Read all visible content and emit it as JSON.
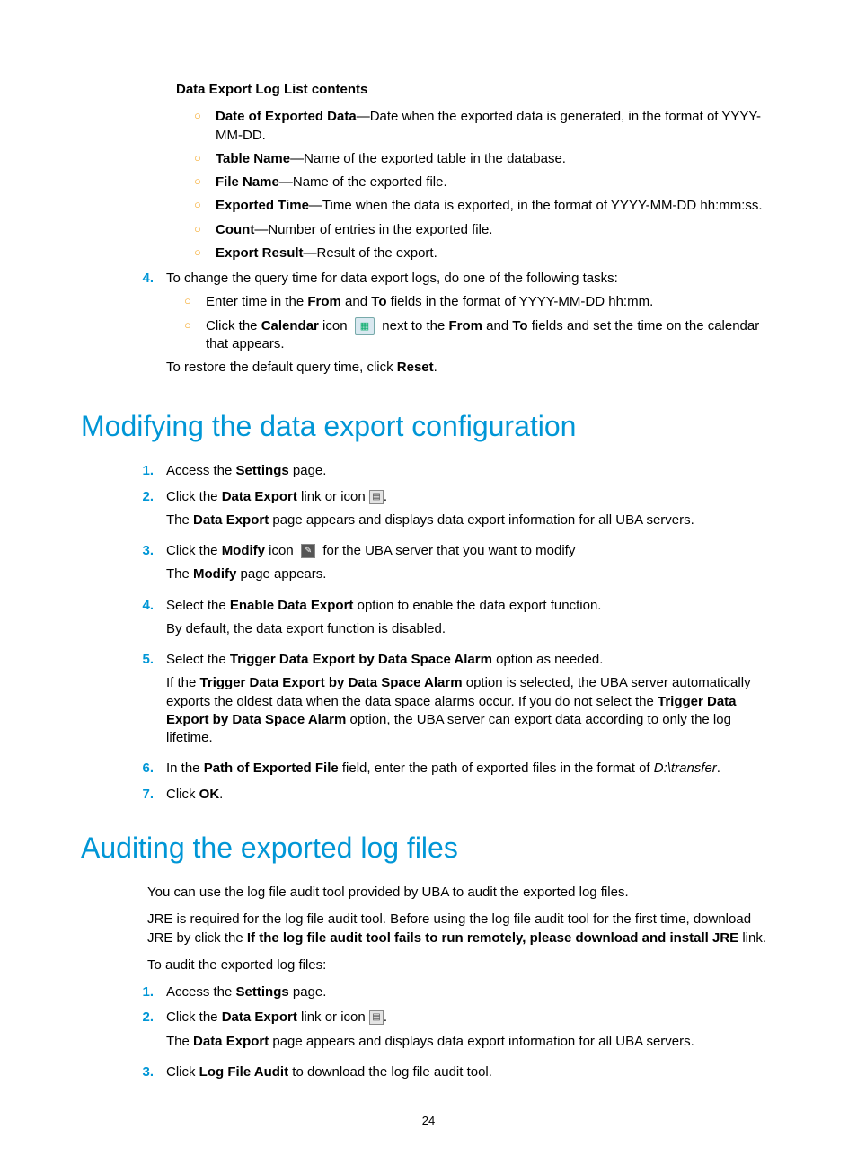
{
  "sectionA": {
    "hdr": "Data Export Log List contents",
    "items": [
      {
        "b": "Date of Exported Data",
        "d": "—Date when the exported data is generated, in the format of YYYY-MM-DD."
      },
      {
        "b": "Table Name",
        "d": "—Name of the exported table in the database."
      },
      {
        "b": "File Name",
        "d": "—Name of the exported file."
      },
      {
        "b": "Exported Time",
        "d": "—Time when the data is exported, in the format of YYYY-MM-DD hh:mm:ss."
      },
      {
        "b": "Count",
        "d": "—Number of entries in the exported file."
      },
      {
        "b": "Export Result",
        "d": "—Result of the export."
      }
    ]
  },
  "step4": {
    "n": "4.",
    "lead": "To change the query time for data export logs, do one of the following tasks:",
    "sub1a": "Enter time in the ",
    "sub1b": "From",
    "sub1c": " and ",
    "sub1d": "To",
    "sub1e": " fields in the format of YYYY-MM-DD hh:mm.",
    "sub2a": "Click the ",
    "sub2b": "Calendar",
    "sub2c": " icon ",
    "sub2d": " next to the ",
    "sub2e": "From",
    "sub2f": " and ",
    "sub2g": "To",
    "sub2h": " fields and set the time on the calendar that appears.",
    "tail1": "To restore the default query time, click ",
    "tail2": "Reset",
    "tail3": "."
  },
  "h1": "Modifying the data export configuration",
  "mod": {
    "s1": {
      "n": "1.",
      "a": "Access the ",
      "b": "Settings",
      "c": " page."
    },
    "s2": {
      "n": "2.",
      "a": "Click the ",
      "b": "Data Export",
      "c": " link or icon ",
      "d": ".",
      "p1a": "The ",
      "p1b": "Data Export",
      "p1c": " page appears and displays data export information for all UBA servers."
    },
    "s3": {
      "n": "3.",
      "a": "Click the ",
      "b": "Modify",
      "c": " icon ",
      "d": " for the UBA server that you want to modify",
      "p1a": "The ",
      "p1b": "Modify",
      "p1c": " page appears."
    },
    "s4": {
      "n": "4.",
      "a": "Select the ",
      "b": "Enable Data Export",
      "c": " option to enable the data export function.",
      "p1": "By default, the data export function is disabled."
    },
    "s5": {
      "n": "5.",
      "a": "Select the ",
      "b": "Trigger Data Export by Data Space Alarm",
      "c": " option as needed.",
      "p1a": "If the ",
      "p1b": "Trigger Data Export by Data Space Alarm",
      "p1c": " option is selected, the UBA server automatically exports the oldest data when the data space alarms occur. If you do not select the ",
      "p1d": "Trigger Data Export by Data Space Alarm",
      "p1e": " option, the UBA server can export data according to only the log lifetime."
    },
    "s6": {
      "n": "6.",
      "a": "In the ",
      "b": "Path of Exported File",
      "c": " field, enter the path of exported files in the format of ",
      "d": "D:\\transfer",
      "e": "."
    },
    "s7": {
      "n": "7.",
      "a": "Click ",
      "b": "OK",
      "c": "."
    }
  },
  "h2": "Auditing the exported log files",
  "aud": {
    "p1": "You can use the log file audit tool provided by UBA to audit the exported log files.",
    "p2a": "JRE is required for the log file audit tool. Before using the log file audit tool for the first time, download JRE by click the ",
    "p2b": "If the log file audit tool fails to run remotely, please download and install JRE",
    "p2c": " link.",
    "p3": "To audit the exported log files:",
    "s1": {
      "n": "1.",
      "a": "Access the ",
      "b": "Settings",
      "c": " page."
    },
    "s2": {
      "n": "2.",
      "a": "Click the ",
      "b": "Data Export",
      "c": " link or icon ",
      "d": ".",
      "p1a": "The ",
      "p1b": "Data Export",
      "p1c": " page appears and displays data export information for all UBA servers."
    },
    "s3": {
      "n": "3.",
      "a": "Click ",
      "b": "Log File Audit",
      "c": " to download the log file audit tool."
    }
  },
  "pagenum": "24"
}
